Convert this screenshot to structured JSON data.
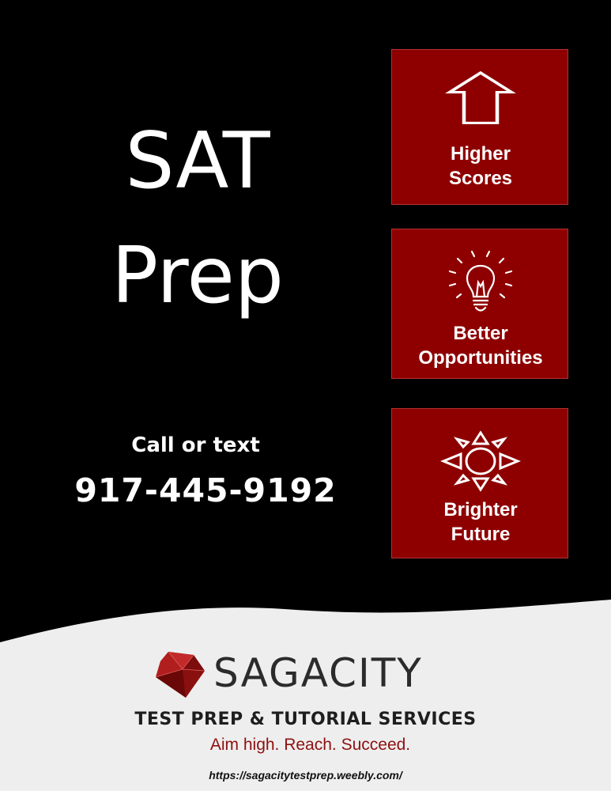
{
  "colors": {
    "background": "#000000",
    "tile": "#8e0000",
    "footer": "#eeeeee",
    "accent": "#8e1010"
  },
  "headline": {
    "line1": "SAT",
    "line2": "Prep"
  },
  "contact": {
    "call_label": "Call or text",
    "phone": "917-445-9192"
  },
  "tiles": [
    {
      "icon": "up-arrow-icon",
      "line1": "Higher",
      "line2": "Scores"
    },
    {
      "icon": "lightbulb-icon",
      "line1": "Better",
      "line2": "Opportunities"
    },
    {
      "icon": "sun-icon",
      "line1": "Brighter",
      "line2": "Future"
    }
  ],
  "footer": {
    "brand": "SAGACITY",
    "services": "TEST PREP & TUTORIAL SERVICES",
    "motto": "Aim high. Reach. Succeed.",
    "url": "https://sagacitytestprep.weebly.com/"
  }
}
